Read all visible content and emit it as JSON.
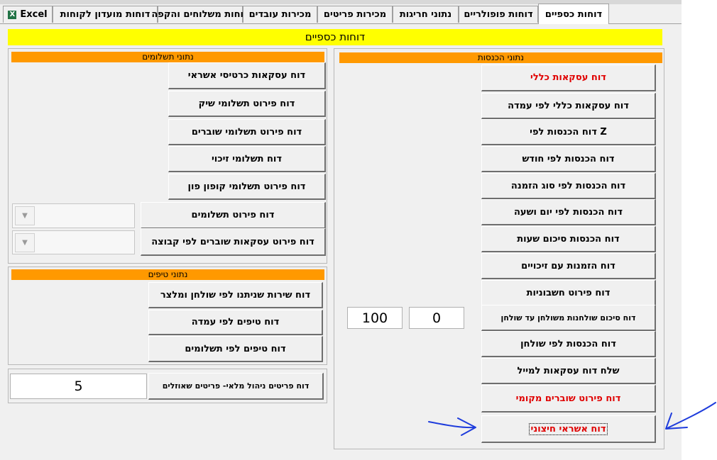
{
  "tabs": {
    "excel": "Excel",
    "customer_club": "דוחות מועדון לקוחות",
    "deliveries_coffee": "דוחות משלוחים והקפה",
    "worker_sales": "משלוחים",
    "worker_sales2": "מכירות עובדים",
    "item_sales": "מכירות פריטים",
    "exceptions": "נתוני חריגות",
    "popular": "דוחות פופולריים",
    "financial": "דוחות כספיים"
  },
  "page_title": "דוחות כספיים",
  "payments": {
    "header": "נתוני תשלומים",
    "buttons": [
      "דוח עסקאות כרטיסי אשראי",
      "דוח פירוט תשלומי שיק",
      "דוח פירוט תשלומי שוברים",
      "דוח תשלומי זיכוי",
      "דוח פירוט תשלומי קופון פון",
      "דוח פירוט תשלומים",
      "דוח פירוט עסקאות שוברים לפי קבוצה"
    ]
  },
  "tips": {
    "header": "נתוני טיפים",
    "buttons": [
      "דוח שירות שניתנו לפי שולחן ומלצר",
      "דוח טיפים לפי עמדה",
      "דוח טיפים לפי תשלומים"
    ]
  },
  "details": {
    "button": "דוח פריטים ניהול מלאי- פריטים שאוזלים",
    "value": "5"
  },
  "income": {
    "header": "נתוני הכנסות",
    "buttons": [
      "דוח עסקאות כללי",
      "דוח עסקאות כללי לפי עמדה",
      "דוח הכנסות לפי Z",
      "דוח הכנסות לפי חודש",
      "דוח הכנסות לפי סוג הזמנה",
      "דוח הכנסות לפי יום ושעה",
      "דוח הכנסות סיכום שעות",
      "דוח הזמנות עם זיכויים",
      "דוח פירוט חשבוניות",
      "דוח סיכום שולחנות משולחן עד שולחן",
      "דוח הכנסות לפי שולחן",
      "שלח דוח עסקאות למייל",
      "דוח פירוט שוברים מקומי",
      "דוח אשראי חיצוני"
    ],
    "table_from": "0",
    "table_to": "100"
  },
  "colors": {
    "orange_header": "#ff9900",
    "title_bar": "#ffff00",
    "red_text": "#e00000",
    "annotation": "#1e3cdc"
  }
}
